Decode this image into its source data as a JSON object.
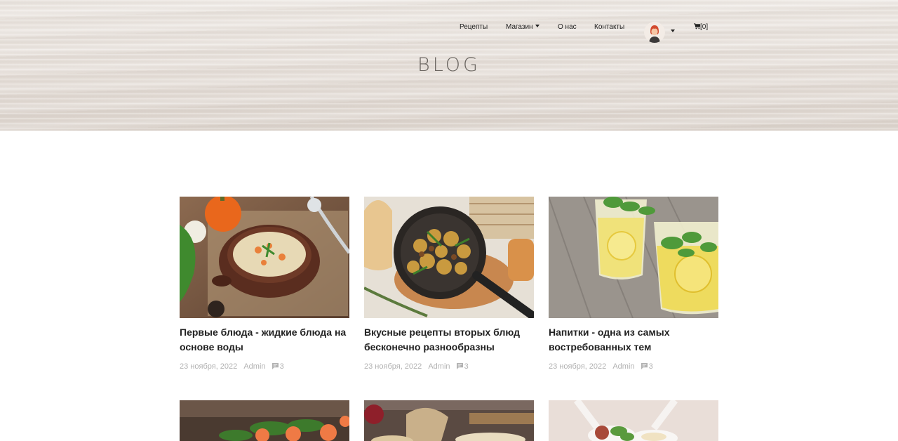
{
  "nav": {
    "items": [
      {
        "label": "Рецепты"
      },
      {
        "label": "Магазин"
      },
      {
        "label": "О нас"
      },
      {
        "label": "Контакты"
      }
    ],
    "cart_label": "[0]",
    "user_icon": "avatar-icon",
    "cart_icon": "cart-icon"
  },
  "hero": {
    "title": "BLOG"
  },
  "posts": [
    {
      "title": "Первые блюда - жидкие блюда на основе воды",
      "date": "23 ноября, 2022",
      "author": "Admin",
      "comments": "3",
      "image": "soup-image"
    },
    {
      "title": "Вкусные рецепты вторых блюд бесконечно разнообразны",
      "date": "23 ноября, 2022",
      "author": "Admin",
      "comments": "3",
      "image": "pan-potatoes-image"
    },
    {
      "title": "Напитки - одна из самых востребованных тем",
      "date": "23 ноября, 2022",
      "author": "Admin",
      "comments": "3",
      "image": "lemonade-image"
    },
    {
      "image": "salmon-herbs-image"
    },
    {
      "image": "bread-table-image"
    },
    {
      "image": "spoons-image"
    }
  ],
  "colors": {
    "accent_text": "#222222",
    "meta_text": "#b2b2b2",
    "hero_bg": "#e8e2dc"
  }
}
